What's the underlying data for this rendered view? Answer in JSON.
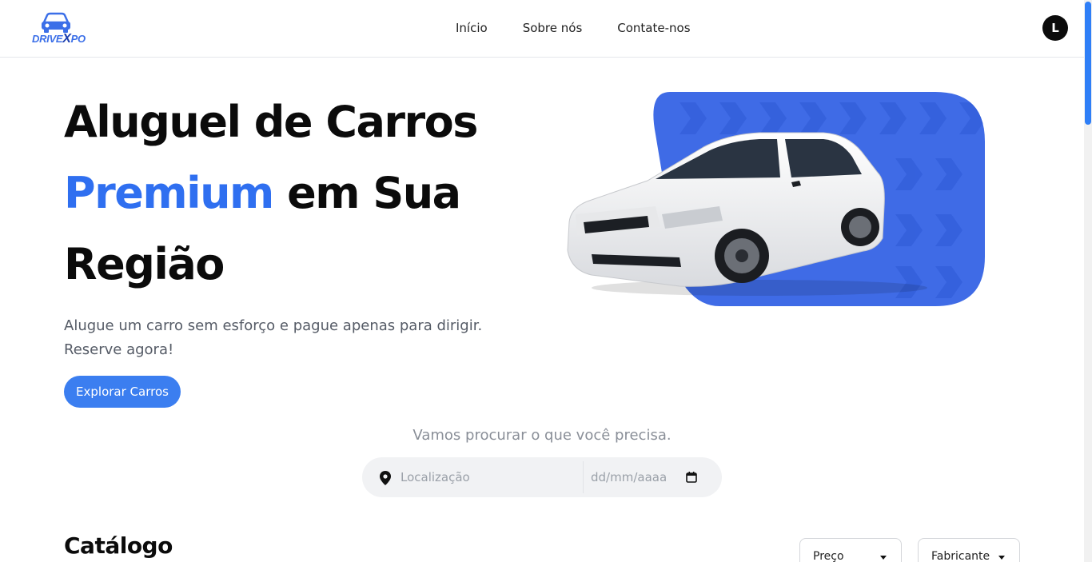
{
  "brand": {
    "logo_prefix": "DRIVE",
    "logo_x": "X",
    "logo_suffix": "PO",
    "icon": "car-icon"
  },
  "nav": {
    "items": [
      {
        "label": "Início"
      },
      {
        "label": "Sobre nós"
      },
      {
        "label": "Contate-nos"
      }
    ]
  },
  "user": {
    "avatar_initial": "L"
  },
  "hero": {
    "title_line1": "Aluguel de Carros",
    "title_accent": "Premium",
    "title_rest": " em Sua",
    "title_line3": "Região",
    "subtitle": "Alugue um carro sem esforço e pague apenas para dirigir. Reserve agora!",
    "cta_label": "Explorar Carros",
    "image": "white-sedan-car-image",
    "accent_color": "#2f6ff0"
  },
  "search": {
    "caption": "Vamos procurar o que você precisa.",
    "location_placeholder": "Localização",
    "date_placeholder": "dd/mm/aaaa",
    "location_icon": "map-pin-icon",
    "date_icon": "calendar-icon"
  },
  "catalog": {
    "title": "Catálogo",
    "filters": [
      {
        "label": "Preço"
      },
      {
        "label": "Fabricante"
      }
    ]
  },
  "colors": {
    "primary": "#3b7ef0",
    "dark": "#0b0b0b",
    "muted": "#555b66"
  }
}
